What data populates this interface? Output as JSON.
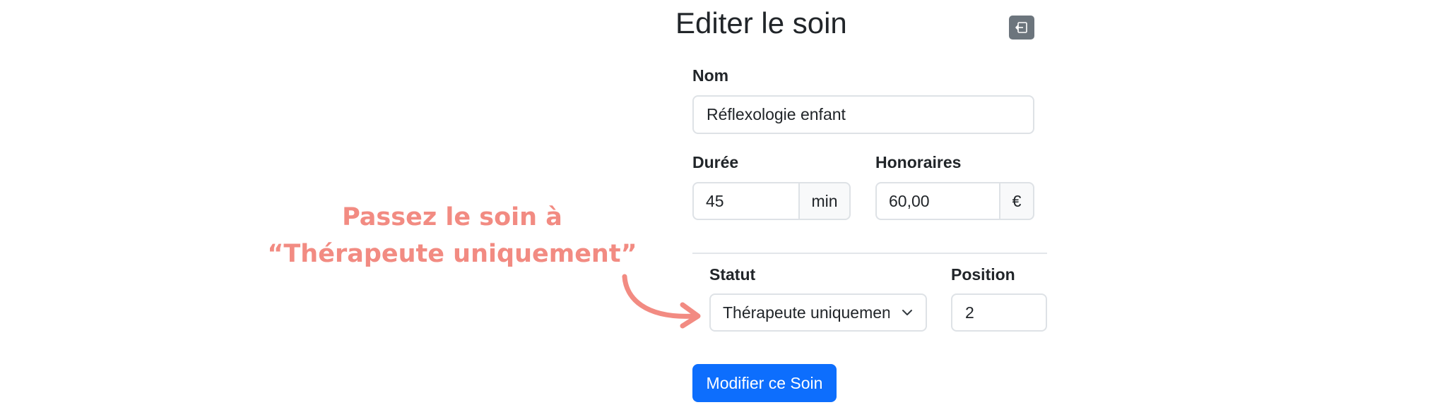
{
  "page": {
    "title": "Editer le soin",
    "back_icon": "exit-icon"
  },
  "form": {
    "nom": {
      "label": "Nom",
      "value": "Réflexologie enfant"
    },
    "duree": {
      "label": "Durée",
      "value": "45",
      "unit": "min"
    },
    "honoraires": {
      "label": "Honoraires",
      "value": "60,00",
      "unit": "€"
    },
    "statut": {
      "label": "Statut",
      "selected": "Thérapeute uniquement"
    },
    "position": {
      "label": "Position",
      "value": "2"
    },
    "submit_label": "Modifier ce Soin"
  },
  "annotation": {
    "line1": "Passez le soin à",
    "line2": "“Thérapeute uniquement”",
    "color": "#f28b82"
  },
  "colors": {
    "primary": "#0d6efd",
    "secondary": "#6c757d",
    "border": "#dee2e6",
    "addon_bg": "#f8f9fa"
  }
}
